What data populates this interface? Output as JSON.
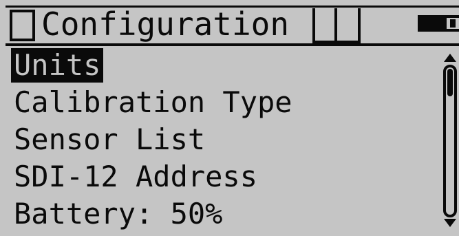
{
  "header": {
    "title": "Configuration",
    "menu_icon": "menu-box-icon",
    "status_icons": [
      "status-slot-icon",
      "status-slot-icon"
    ],
    "battery_icon": "battery-icon"
  },
  "menu": {
    "items": [
      {
        "label": "Units",
        "selected": true
      },
      {
        "label": "Calibration Type",
        "selected": false
      },
      {
        "label": "Sensor List",
        "selected": false
      },
      {
        "label": "SDI-12 Address",
        "selected": false
      },
      {
        "label": "Battery: 50%",
        "selected": false
      }
    ]
  },
  "scrollbar": {
    "up_icon": "arrow-up-icon",
    "down_icon": "arrow-down-icon"
  },
  "colors": {
    "background": "#c5c5c5",
    "foreground": "#0a0a0a"
  }
}
